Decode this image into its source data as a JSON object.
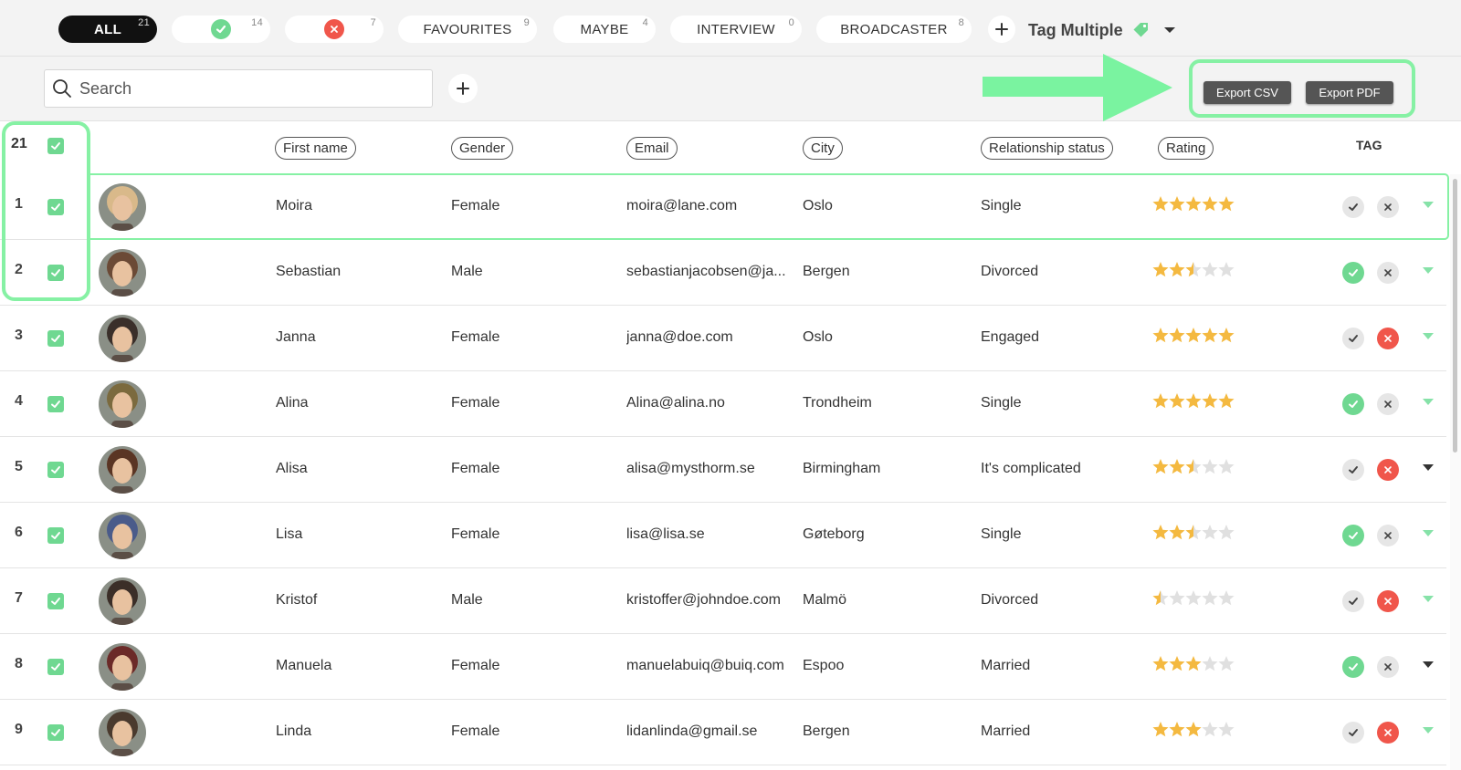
{
  "filters": {
    "tabs": [
      {
        "label": "ALL",
        "count": "21"
      },
      {
        "label": "",
        "count": "14",
        "icon": "check-icon"
      },
      {
        "label": "",
        "count": "7",
        "icon": "x-icon"
      },
      {
        "label": "FAVOURITES",
        "count": "9"
      },
      {
        "label": "MAYBE",
        "count": "4"
      },
      {
        "label": "INTERVIEW",
        "count": "0"
      },
      {
        "label": "BROADCASTER",
        "count": "8"
      }
    ],
    "tag_multiple_label": "Tag Multiple"
  },
  "toolbar": {
    "search_placeholder": "Search",
    "export_csv_label": "Export CSV",
    "export_pdf_label": "Export PDF"
  },
  "table": {
    "selected_count": "21",
    "columns": {
      "first_name": "First name",
      "gender": "Gender",
      "email": "Email",
      "city": "City",
      "relationship": "Relationship status",
      "rating": "Rating",
      "tag": "TAG"
    },
    "rows": [
      {
        "index": "1",
        "name": "Moira",
        "gender": "Female",
        "email": "moira@lane.com",
        "city": "Oslo",
        "relationship": "Single",
        "rating": 5,
        "approved": false,
        "rejected": false,
        "expanded": false,
        "avatar_color": "#d9b98a"
      },
      {
        "index": "2",
        "name": "Sebastian",
        "gender": "Male",
        "email": "sebastianjacobsen@ja...",
        "city": "Bergen",
        "relationship": "Divorced",
        "rating": 2.5,
        "approved": true,
        "rejected": false,
        "expanded": false,
        "avatar_color": "#6b4a36"
      },
      {
        "index": "3",
        "name": "Janna",
        "gender": "Female",
        "email": "janna@doe.com",
        "city": "Oslo",
        "relationship": "Engaged",
        "rating": 5,
        "approved": false,
        "rejected": true,
        "expanded": false,
        "avatar_color": "#3a2f2a"
      },
      {
        "index": "4",
        "name": "Alina",
        "gender": "Female",
        "email": "Alina@alina.no",
        "city": "Trondheim",
        "relationship": "Single",
        "rating": 5,
        "approved": true,
        "rejected": false,
        "expanded": false,
        "avatar_color": "#7b6a3e"
      },
      {
        "index": "5",
        "name": "Alisa",
        "gender": "Female",
        "email": "alisa@mysthorm.se",
        "city": "Birmingham",
        "relationship": "It's complicated",
        "rating": 2.5,
        "approved": false,
        "rejected": true,
        "expanded": true,
        "avatar_color": "#5a3524"
      },
      {
        "index": "6",
        "name": "Lisa",
        "gender": "Female",
        "email": "lisa@lisa.se",
        "city": "Gøteborg",
        "relationship": "Single",
        "rating": 2.5,
        "approved": true,
        "rejected": false,
        "expanded": false,
        "avatar_color": "#4a5b8a"
      },
      {
        "index": "7",
        "name": "Kristof",
        "gender": "Male",
        "email": "kristoffer@johndoe.com",
        "city": "Malmö",
        "relationship": "Divorced",
        "rating": 0.5,
        "approved": false,
        "rejected": true,
        "expanded": false,
        "avatar_color": "#3b2e28"
      },
      {
        "index": "8",
        "name": "Manuela",
        "gender": "Female",
        "email": "manuelabuiq@buiq.com",
        "city": "Espoo",
        "relationship": "Married",
        "rating": 3,
        "approved": true,
        "rejected": false,
        "expanded": true,
        "avatar_color": "#6b2a28"
      },
      {
        "index": "9",
        "name": "Linda",
        "gender": "Female",
        "email": "lidanlinda@gmail.se",
        "city": "Bergen",
        "relationship": "Married",
        "rating": 3,
        "approved": false,
        "rejected": true,
        "expanded": false,
        "avatar_color": "#4a3a2e"
      }
    ]
  },
  "colors": {
    "accent_green": "#6fd891",
    "highlight_green": "#86f1a4",
    "reject_red": "#f0564b",
    "star_gold": "#f4b940",
    "star_grey": "#e0e0e0"
  }
}
